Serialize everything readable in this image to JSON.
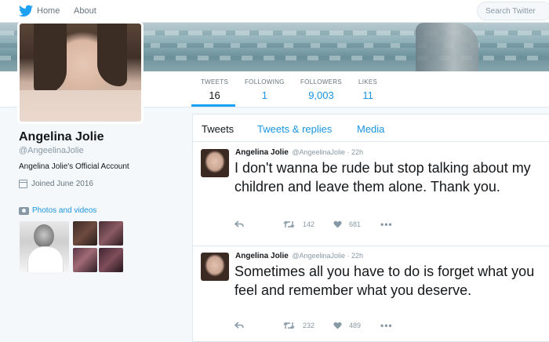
{
  "nav": {
    "home": "Home",
    "about": "About",
    "search_placeholder": "Search Twitter"
  },
  "icons": [
    "twitter-bird-icon",
    "calendar-icon",
    "camera-icon",
    "reply-icon",
    "retweet-icon",
    "heart-icon",
    "more-icon"
  ],
  "colors": {
    "brand": "#1da1f2",
    "link": "#1b95e0",
    "muted": "#8899a6"
  },
  "stats": [
    {
      "label": "TWEETS",
      "value": "16"
    },
    {
      "label": "FOLLOWING",
      "value": "1"
    },
    {
      "label": "FOLLOWERS",
      "value": "9,003"
    },
    {
      "label": "LIKES",
      "value": "11"
    }
  ],
  "profile": {
    "name": "Angelina Jolie",
    "handle": "@AngeelinaJolie",
    "bio": "Angelina Jolie's Official Account",
    "joined": "Joined June 2016",
    "photos_link": "Photos and videos"
  },
  "tabs": [
    "Tweets",
    "Tweets & replies",
    "Media"
  ],
  "tweets": [
    {
      "name": "Angelina Jolie",
      "meta": "@AngeelinaJolie · 22h",
      "text": "I don't wanna be rude but stop talking about my children and leave them alone. Thank you.",
      "retweets": "142",
      "likes": "681"
    },
    {
      "name": "Angelina Jolie",
      "meta": "@AngeelinaJolie · 22h",
      "text": "Sometimes all you have to do is forget what you feel and remember what you deserve.",
      "retweets": "232",
      "likes": "489"
    }
  ]
}
